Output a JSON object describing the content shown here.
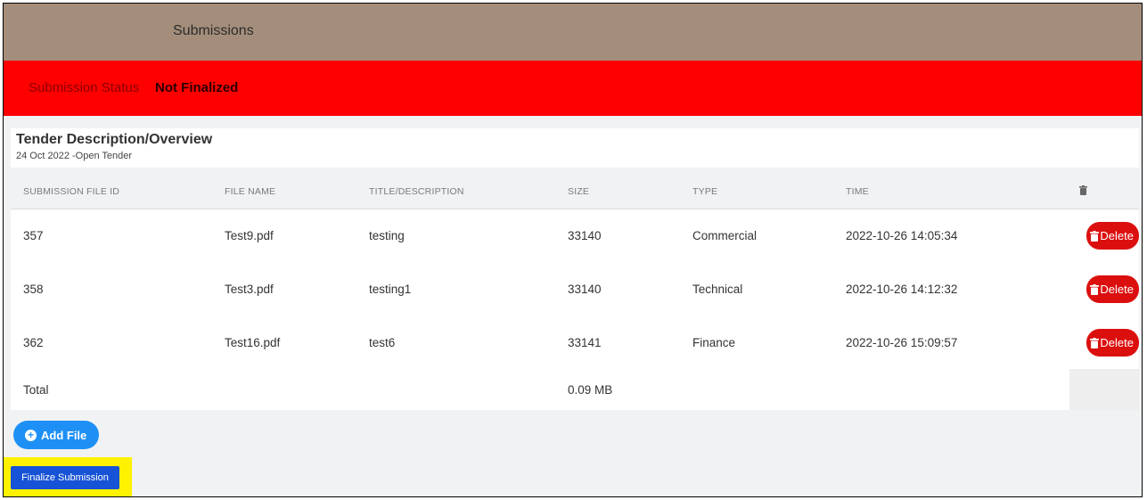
{
  "header": {
    "title": "Submissions"
  },
  "status": {
    "label": "Submission Status",
    "value": "Not Finalized"
  },
  "overview": {
    "title": "Tender Description/Overview",
    "subtitle": "24 Oct 2022 -Open Tender"
  },
  "table": {
    "columns": [
      "SUBMISSION FILE ID",
      "FILE NAME",
      "TITLE/DESCRIPTION",
      "SIZE",
      "TYPE",
      "TIME"
    ],
    "delete_col_icon": "trash-icon",
    "rows": [
      {
        "id": "357",
        "file": "Test9.pdf",
        "title": "testing",
        "size": "33140",
        "type": "Commercial",
        "time": "2022-10-26 14:05:34",
        "action": "Delete"
      },
      {
        "id": "358",
        "file": "Test3.pdf",
        "title": "testing1",
        "size": "33140",
        "type": "Technical",
        "time": "2022-10-26 14:12:32",
        "action": "Delete"
      },
      {
        "id": "362",
        "file": "Test16.pdf",
        "title": "test6",
        "size": "33141",
        "type": "Finance",
        "time": "2022-10-26 15:09:57",
        "action": "Delete"
      }
    ],
    "total": {
      "label": "Total",
      "size": "0.09 MB"
    }
  },
  "actions": {
    "add_file": "Add File",
    "finalize": "Finalize Submission"
  },
  "colors": {
    "header_bg": "#a48e7b",
    "status_bg": "#fe0000",
    "delete_btn": "#dc0f0f",
    "add_btn": "#1e90f5",
    "finalize_btn": "#1753d6",
    "highlight": "#fff200"
  }
}
